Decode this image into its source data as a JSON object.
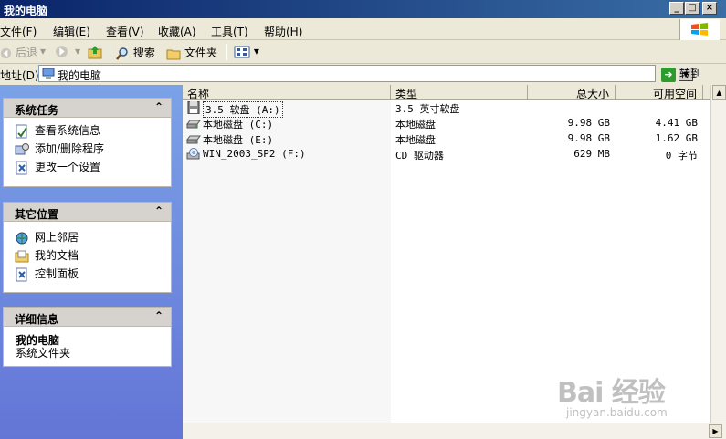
{
  "window": {
    "title": "我的电脑",
    "controls": {
      "minimize": "_",
      "maximize": "□",
      "close": "×"
    }
  },
  "menu": {
    "items": [
      "文件(F)",
      "编辑(E)",
      "查看(V)",
      "收藏(A)",
      "工具(T)",
      "帮助(H)"
    ]
  },
  "toolbar": {
    "back": "后退",
    "search": "搜索",
    "folders": "文件夹"
  },
  "address": {
    "label": "地址(D)",
    "value": "我的电脑",
    "go": "转到"
  },
  "tasks": {
    "system": {
      "title": "系统任务",
      "items": [
        "查看系统信息",
        "添加/删除程序",
        "更改一个设置"
      ]
    },
    "other": {
      "title": "其它位置",
      "items": [
        "网上邻居",
        "我的文档",
        "控制面板"
      ]
    },
    "details": {
      "title": "详细信息",
      "name": "我的电脑",
      "type": "系统文件夹"
    }
  },
  "list": {
    "columns": [
      "名称",
      "类型",
      "总大小",
      "可用空间"
    ],
    "rows": [
      {
        "name": "3.5 软盘 (A:)",
        "type": "3.5 英寸软盘",
        "total": "",
        "free": "",
        "icon": "floppy-icon"
      },
      {
        "name": "本地磁盘 (C:)",
        "type": "本地磁盘",
        "total": "9.98 GB",
        "free": "4.41 GB",
        "icon": "hard-drive-icon"
      },
      {
        "name": "本地磁盘 (E:)",
        "type": "本地磁盘",
        "total": "9.98 GB",
        "free": "1.62 GB",
        "icon": "hard-drive-icon"
      },
      {
        "name": "WIN_2003_SP2 (F:)",
        "type": "CD 驱动器",
        "total": "629 MB",
        "free": "0 字节",
        "icon": "cd-drive-icon"
      }
    ]
  },
  "watermark": {
    "logo": "Bai 经验",
    "url": "jingyan.baidu.com"
  }
}
